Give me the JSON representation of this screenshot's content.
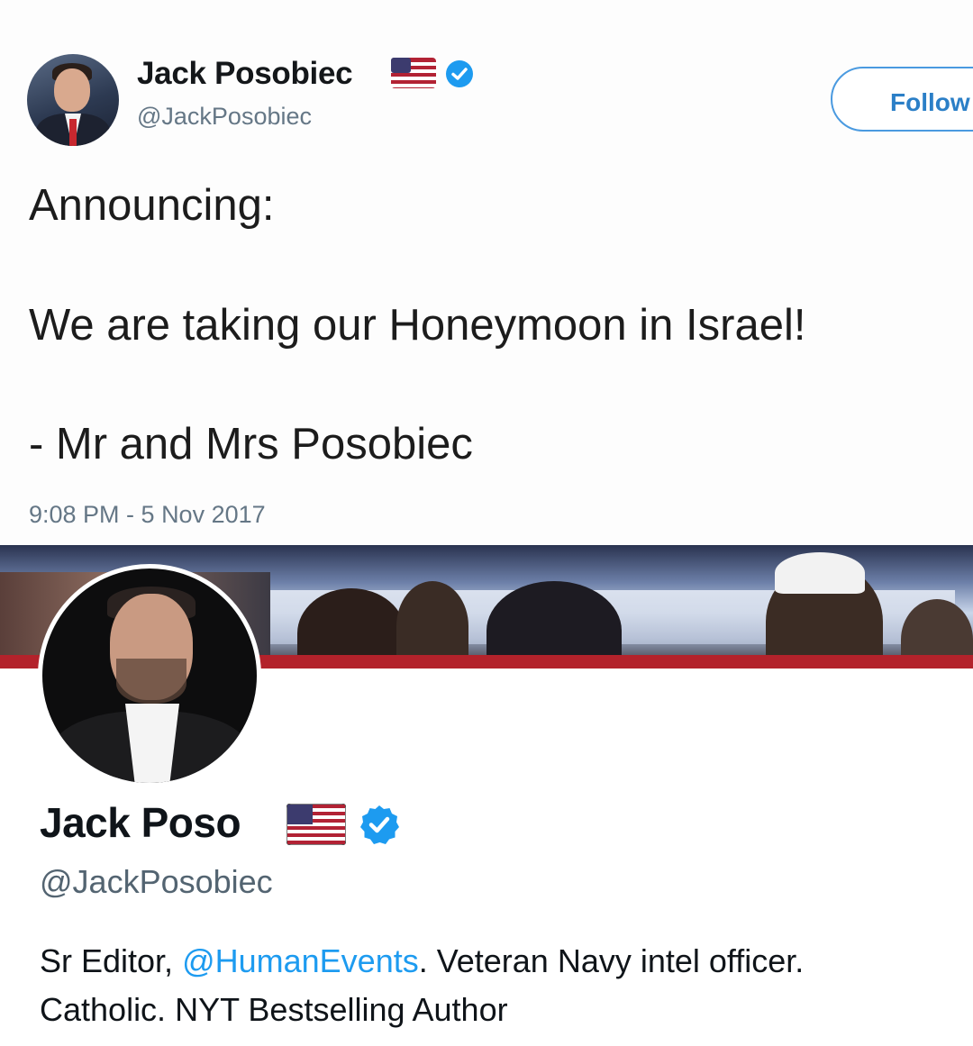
{
  "tweet": {
    "author_name": "Jack Posobiec",
    "author_handle": "@JackPosobiec",
    "follow_label": "Follow",
    "lines": [
      "Announcing:",
      "We are taking our Honeymoon in Israel!",
      "- Mr and Mrs Posobiec"
    ],
    "timestamp": "9:08 PM - 5 Nov 2017"
  },
  "profile": {
    "display_name": "Jack Poso",
    "handle": "@JackPosobiec",
    "bio_prefix": "Sr Editor, ",
    "bio_mention": "@HumanEvents",
    "bio_line1_rest": ". Veteran Navy intel officer.",
    "bio_line2": "Catholic. NYT Bestselling Author"
  },
  "colors": {
    "verified_blue": "#1d9bf0",
    "link_blue": "#1d9bf0",
    "follow_border": "#4a9ae0"
  },
  "icons": {
    "flag": "us-flag-icon",
    "verified": "verified-badge-icon"
  }
}
